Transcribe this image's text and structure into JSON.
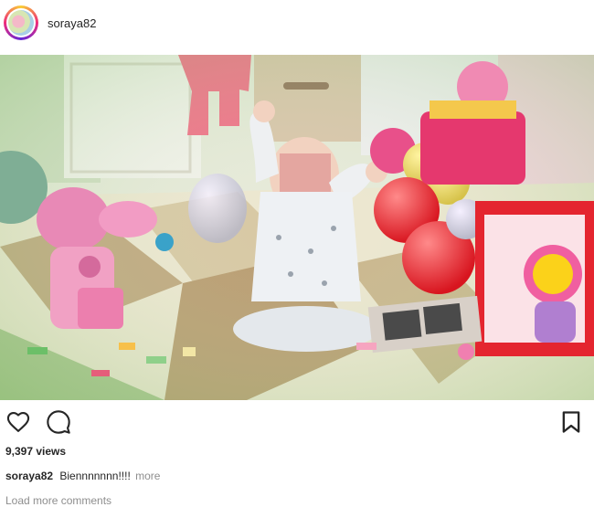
{
  "header": {
    "username": "soraya82",
    "avatar_icon": "profile-avatar"
  },
  "post": {
    "image_alt": "baby-playing-with-toys-and-balloons",
    "icons": {
      "like": "heart-icon",
      "comment": "comment-icon",
      "save": "bookmark-icon"
    },
    "views": "9,397 views",
    "caption_user": "soraya82",
    "caption_text": "Biennnnnnn!!!!",
    "caption_more": "more",
    "load_more": "Load more comments"
  },
  "colors": {
    "text": "#262626",
    "muted": "#8e8e8e",
    "ring": "#ee2a7b"
  }
}
